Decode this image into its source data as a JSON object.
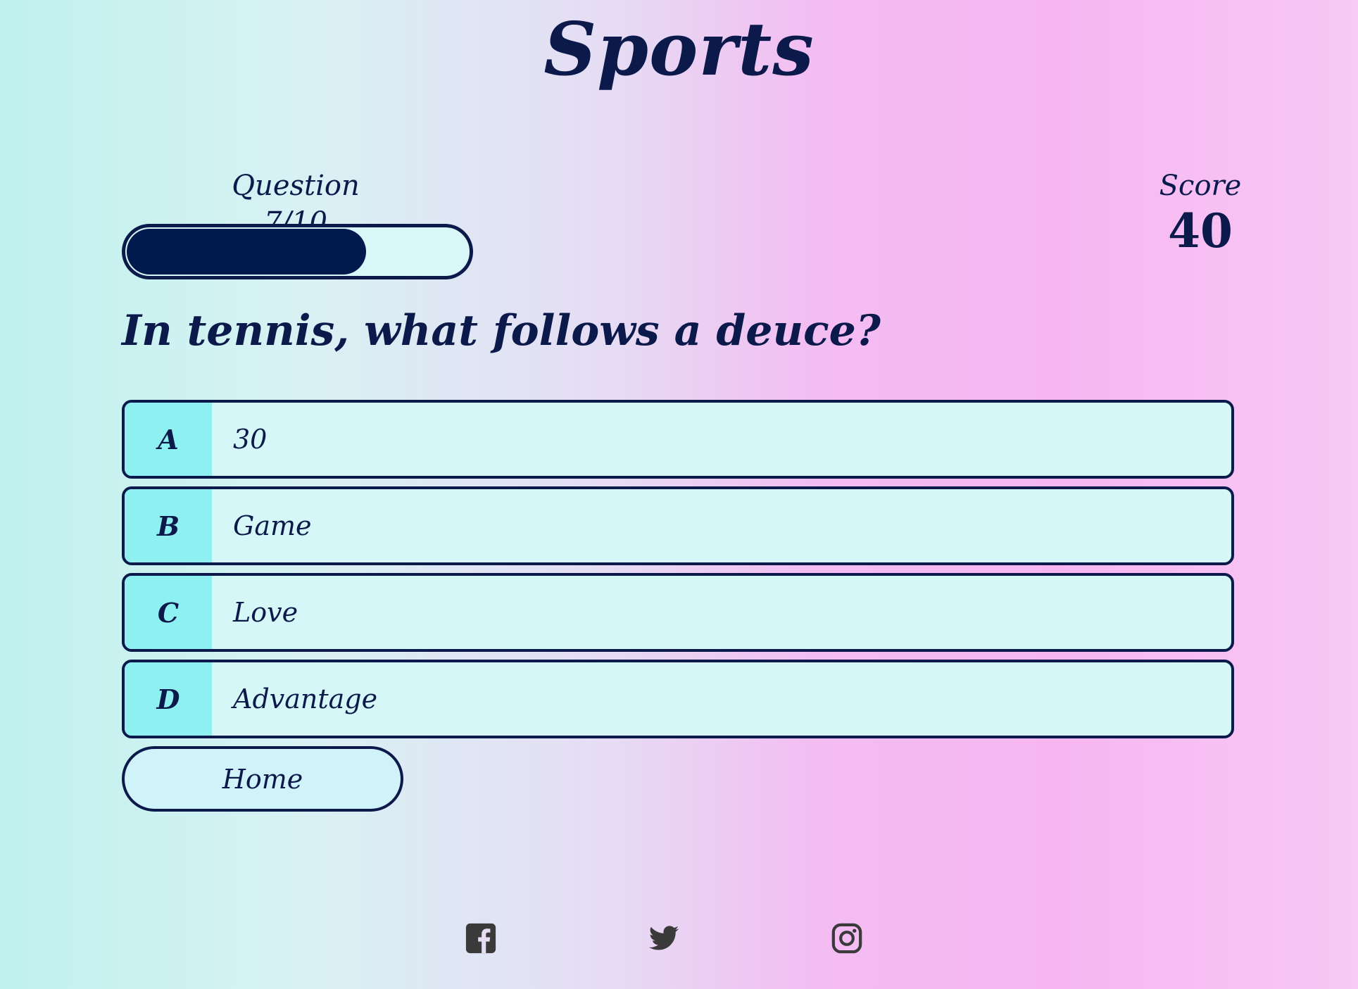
{
  "header": {
    "title": "Sports"
  },
  "progress": {
    "counter_text": "Question 7/10",
    "current": 7,
    "total": 10,
    "fill_fraction": 0.7
  },
  "score": {
    "label": "Score",
    "value": "40"
  },
  "question": {
    "text": "In tennis, what follows a deuce?"
  },
  "answers": [
    {
      "letter": "A",
      "text": "30"
    },
    {
      "letter": "B",
      "text": "Game"
    },
    {
      "letter": "C",
      "text": "Love"
    },
    {
      "letter": "D",
      "text": "Advantage"
    }
  ],
  "home_button": {
    "label": "Home"
  },
  "footer": {
    "icons": [
      "facebook-icon",
      "twitter-icon",
      "instagram-icon"
    ]
  },
  "colors": {
    "primary": "#0b1a4a",
    "progress_fill": "#001a4d",
    "answer_background": "#d6f7f8",
    "letter_background": "#8ef0f0",
    "icon_color": "#3a3a3a"
  }
}
